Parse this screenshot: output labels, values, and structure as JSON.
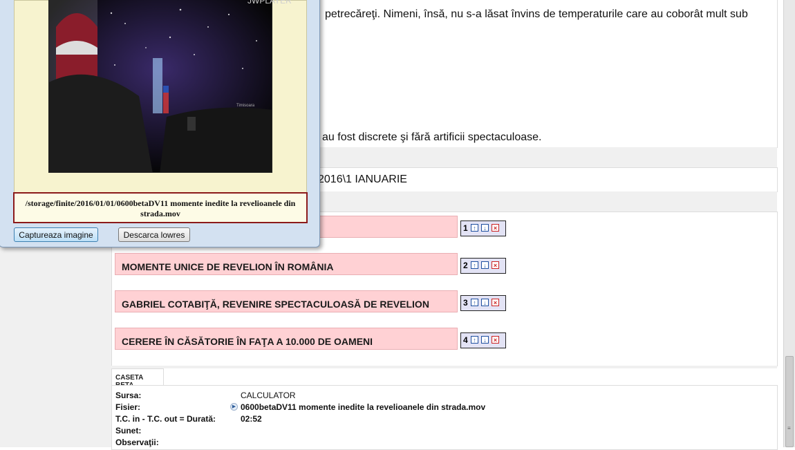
{
  "article": {
    "line1": "petrecăreţi. Nimeni, însă, nu s-a lăsat învins de temperaturile care au coborât mult sub",
    "line2": "au fost discrete şi fără artificii spectaculoase."
  },
  "date_path": "2016\\1 IANUARIE",
  "items": [
    {
      "title": "",
      "num": "1"
    },
    {
      "title": "MOMENTE UNICE DE REVELION ÎN ROMÂNIA",
      "num": "2"
    },
    {
      "title": "GABRIEL COTABIŢĂ, REVENIRE SPECTACULOASĂ DE REVELION",
      "num": "3"
    },
    {
      "title": "CERERE ÎN CĂSĂTORIE ÎN FAŢA A 10.000 DE OAMENI",
      "num": "4"
    }
  ],
  "tab_label": "CASETA BETA",
  "meta": {
    "sursa_label": "Sursa:",
    "sursa_value": "CALCULATOR",
    "fisier_label": "Fisier:",
    "fisier_value": "0600betaDV11 momente inedite la revelioanele din strada.mov",
    "tc_label": "T.C. in - T.C. out = Durată:",
    "tc_value": "02:52",
    "sunet_label": "Sunet:",
    "obs_label": "Observaţii:"
  },
  "popup": {
    "watermark": "JWPLAYER",
    "video_caption": "Timisoara",
    "path": "/storage/finite/2016/01/01/0600betaDV11 momente inedite la revelioanele din strada.mov",
    "capture_button": "Captureaza imagine",
    "download_button": "Descarca lowres"
  },
  "icons": {
    "up": "arrow-up-icon",
    "down": "arrow-down-icon",
    "delete": "delete-x-icon",
    "file": "play-arrow-icon"
  },
  "colors": {
    "item_bg": "#ffd1d4",
    "ctrl_bg": "#e3e3f5",
    "path_border": "#8b1a1a",
    "popup_bg": "#d3e1f1"
  }
}
